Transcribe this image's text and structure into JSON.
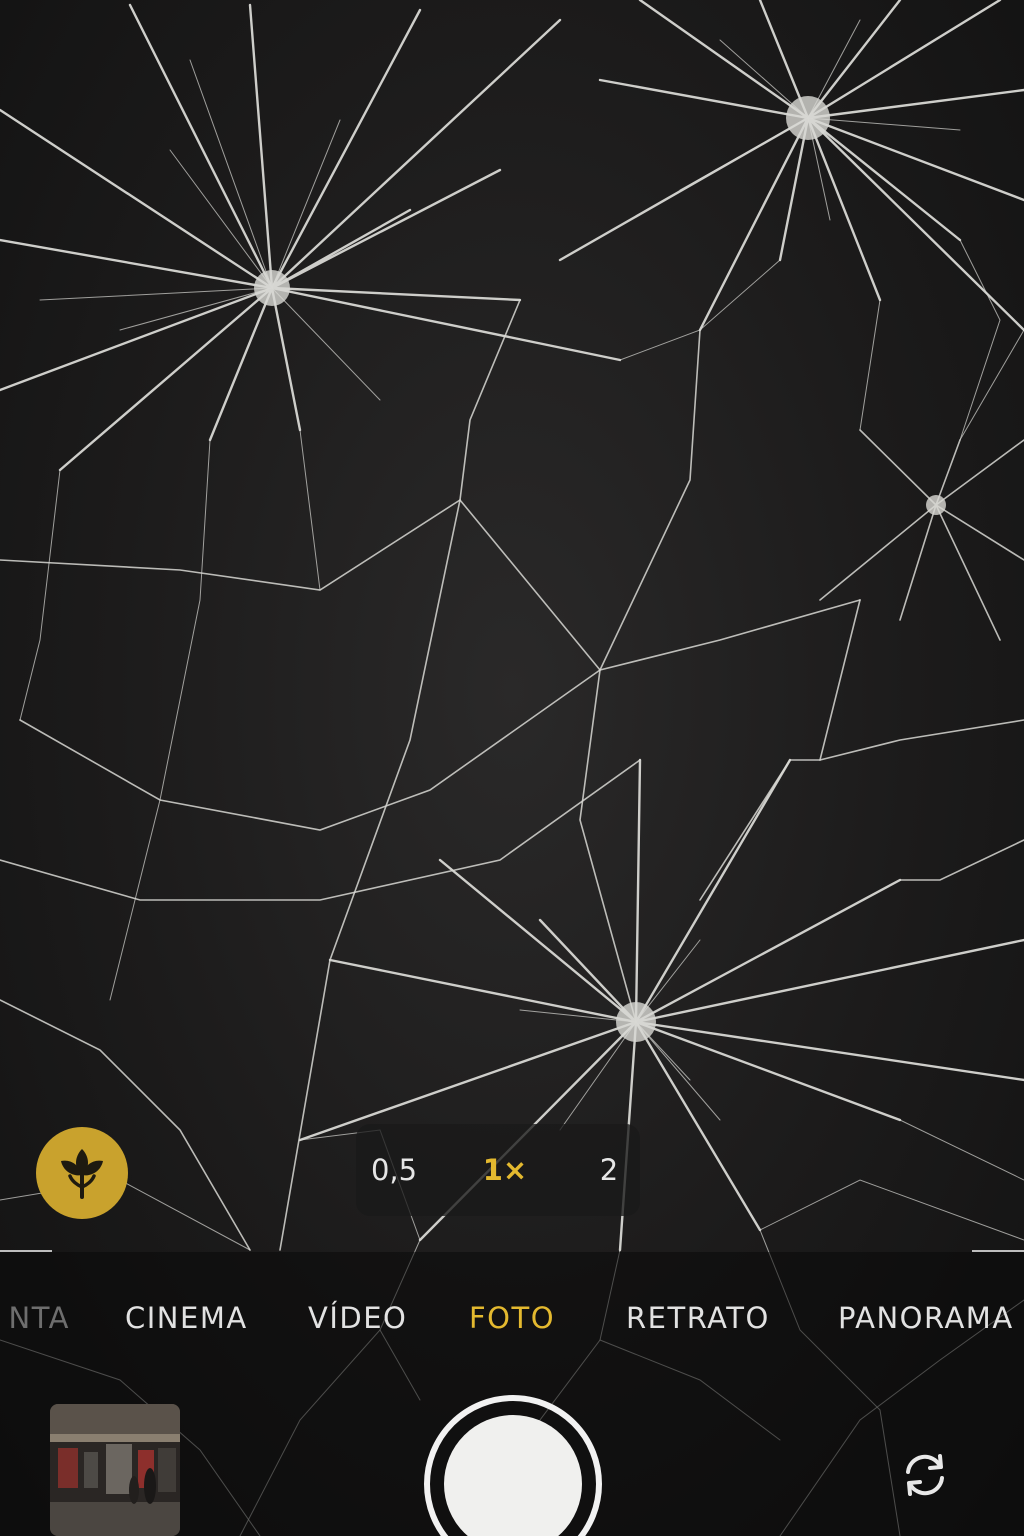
{
  "camera": {
    "zoom": {
      "options": [
        "0,5",
        "1×",
        "2"
      ],
      "selected": "1×"
    },
    "modes": {
      "items": [
        "NTA",
        "CINEMA",
        "VÍDEO",
        "FOTO",
        "RETRATO",
        "PANORAMA"
      ],
      "selected": "FOTO"
    },
    "macro": {
      "icon": "macro-flower-icon",
      "active": true
    },
    "controls": {
      "shutter_icon": "shutter-circle",
      "flip_icon": "camera-flip-icon",
      "gallery_icon": "gallery-thumbnail"
    },
    "colors": {
      "accent": "#e4b92f",
      "macro_bg": "#c9a22d",
      "text": "#e2e2e2",
      "viewfinder": "#1c1b1b"
    }
  }
}
